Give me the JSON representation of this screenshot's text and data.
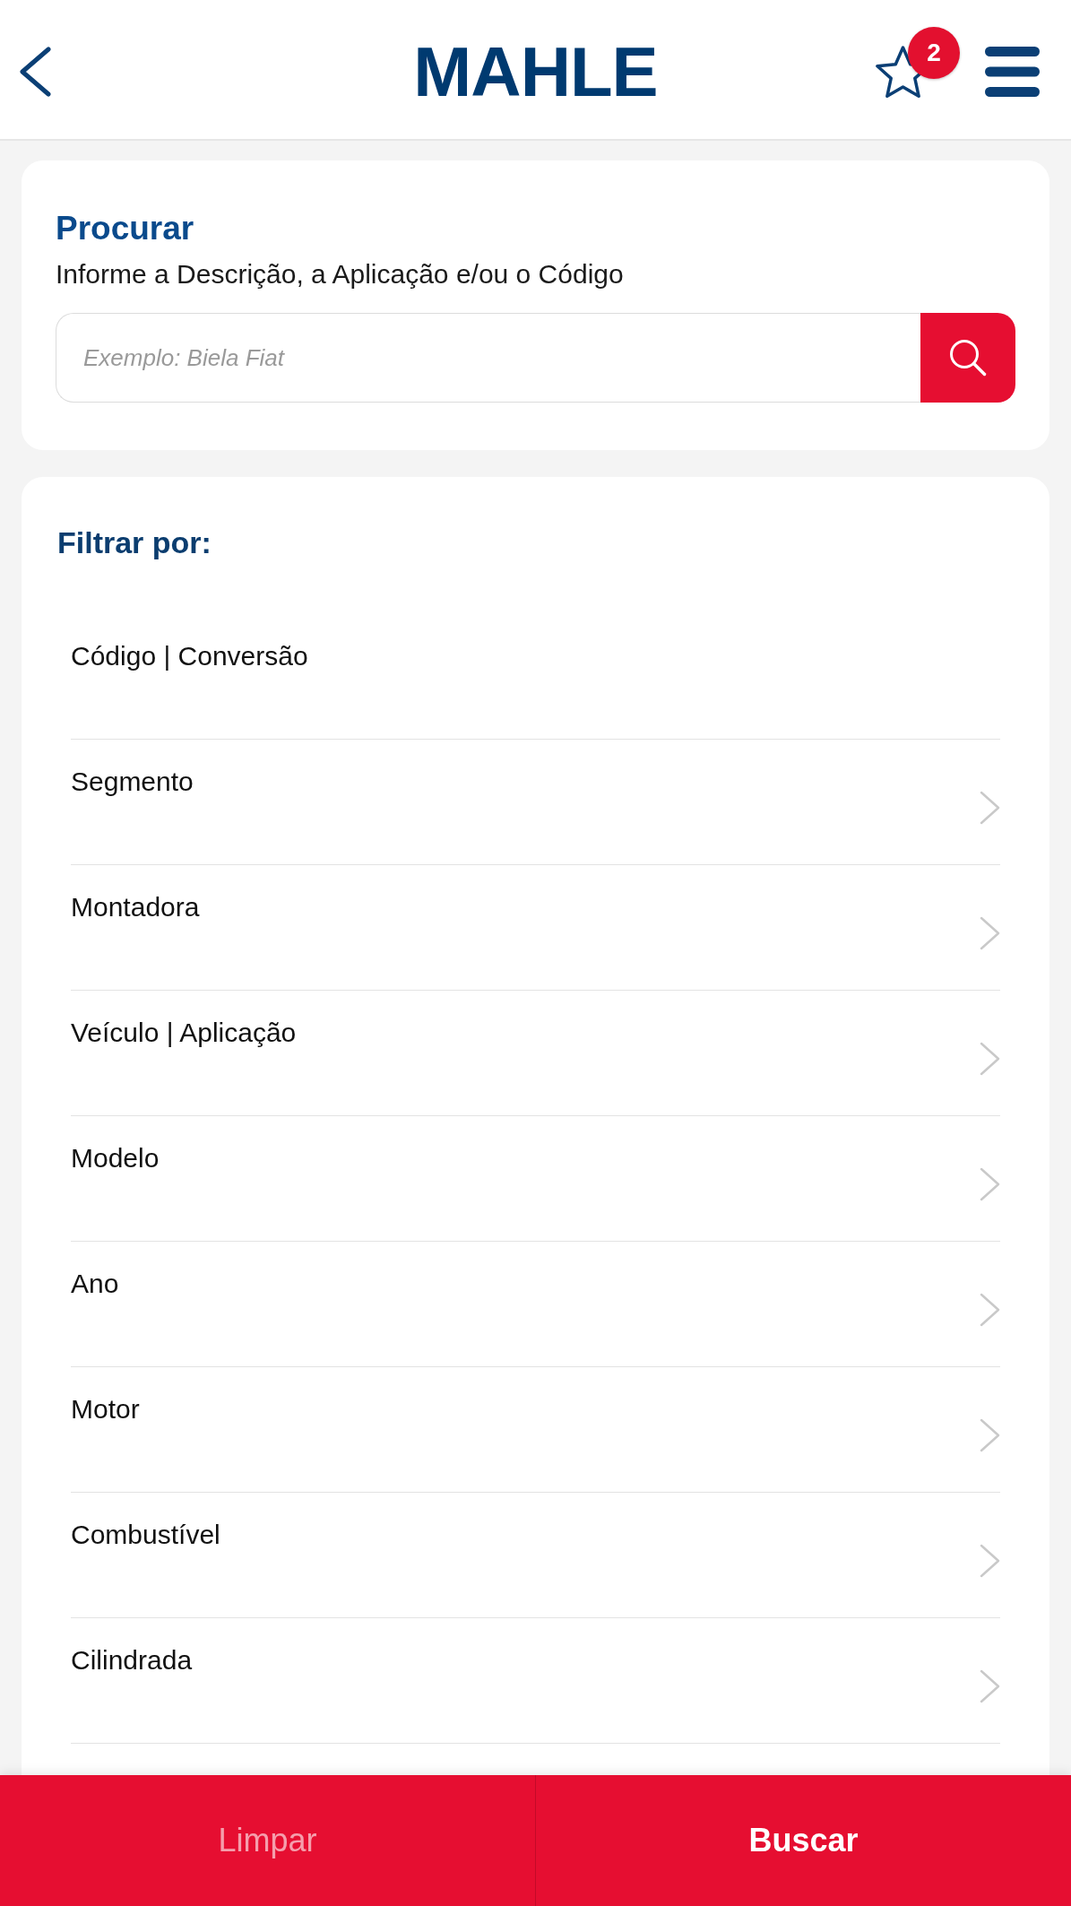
{
  "header": {
    "logo": "MAHLE",
    "favorites_badge": "2"
  },
  "search": {
    "title": "Procurar",
    "subtitle": "Informe a Descrição, a Aplicação e/ou o Código",
    "placeholder": "Exemplo: Biela Fiat"
  },
  "filters": {
    "title": "Filtrar por:",
    "items": [
      {
        "label": "Código | Conversão",
        "kind": "plain"
      },
      {
        "label": "Segmento",
        "kind": "submenu"
      },
      {
        "label": "Montadora",
        "kind": "submenu"
      },
      {
        "label": "Veículo | Aplicação",
        "kind": "submenu"
      },
      {
        "label": "Modelo",
        "kind": "submenu"
      },
      {
        "label": "Ano",
        "kind": "submenu"
      },
      {
        "label": "Motor",
        "kind": "submenu"
      },
      {
        "label": "Combustível",
        "kind": "submenu"
      },
      {
        "label": "Cilindrada",
        "kind": "submenu"
      }
    ]
  },
  "footer": {
    "buttons": [
      {
        "label": "Limpar",
        "disabled": true
      },
      {
        "label": "Buscar",
        "disabled": false
      }
    ]
  }
}
